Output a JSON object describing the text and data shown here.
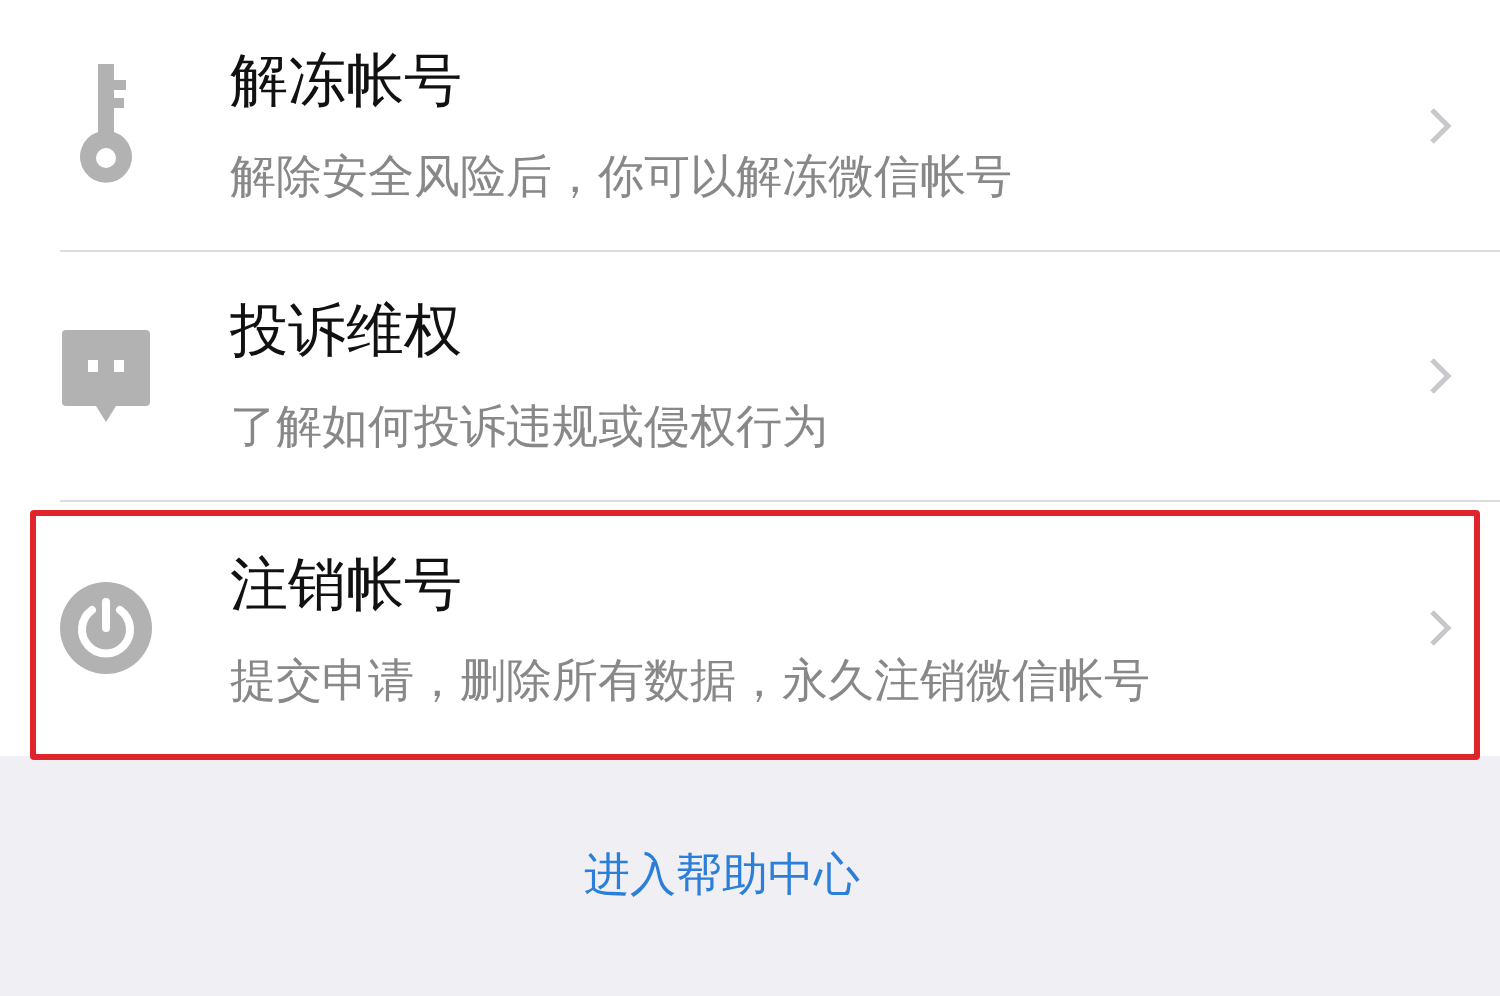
{
  "items": [
    {
      "kind": "key",
      "title": "解冻帐号",
      "subtitle": "解除安全风险后，你可以解冻微信帐号",
      "highlighted": false
    },
    {
      "kind": "chat",
      "title": "投诉维权",
      "subtitle": "了解如何投诉违规或侵权行为",
      "highlighted": false
    },
    {
      "kind": "power",
      "title": "注销帐号",
      "subtitle": "提交申请，删除所有数据，永久注销微信帐号",
      "highlighted": true
    }
  ],
  "help_link": "进入帮助中心"
}
